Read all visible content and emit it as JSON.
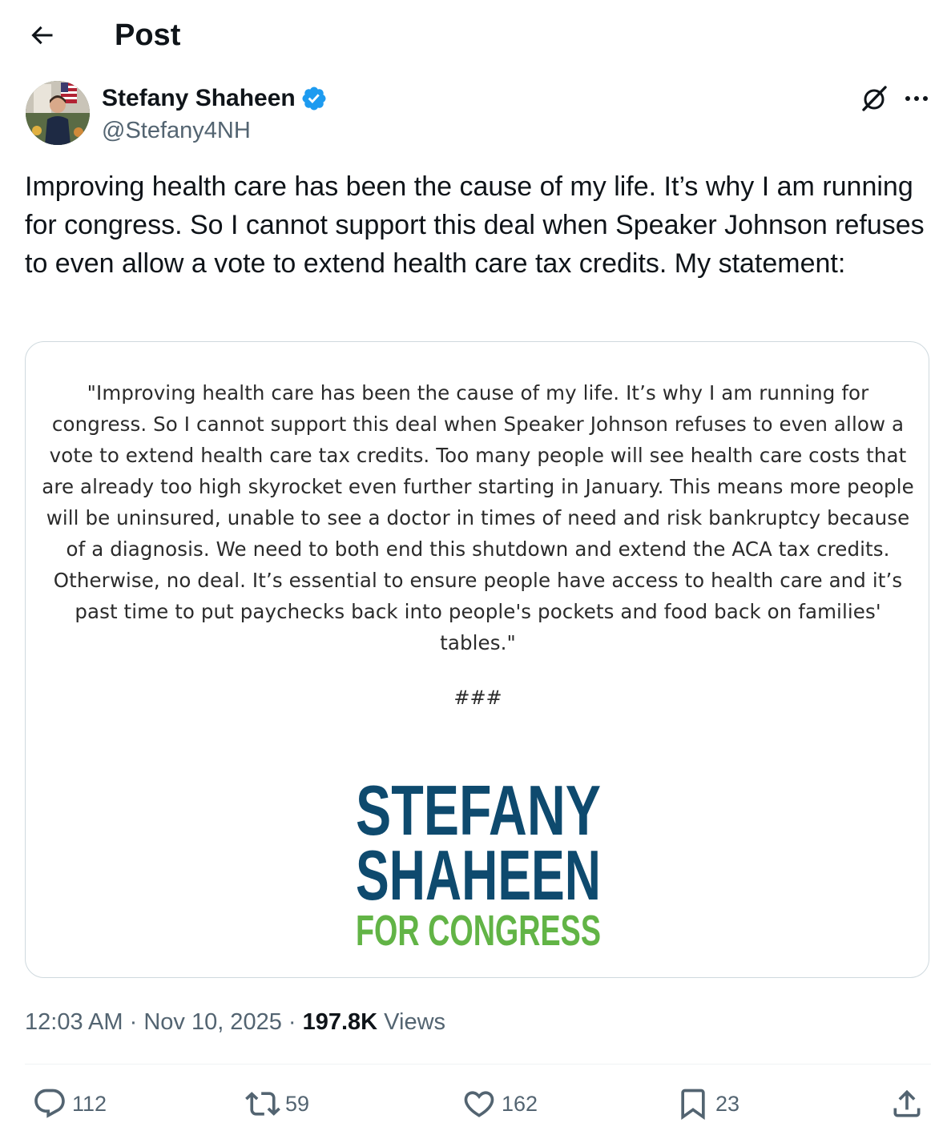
{
  "header": {
    "title": "Post",
    "back_icon": "back-arrow-icon"
  },
  "author": {
    "name": "Stefany Shaheen",
    "handle": "@Stefany4NH",
    "verified": true,
    "verified_color": "#1d9bf0"
  },
  "tweet": {
    "text": "Improving health care has been the cause of my life. It’s why I am running for congress. So I cannot support this deal when Speaker Johnson refuses to even allow a vote to extend health care tax credits. My statement:"
  },
  "card": {
    "statement": "\"Improving health care has been the cause of my life. It’s why I am running for congress. So I cannot support this deal when Speaker Johnson refuses to even allow a vote to extend health care tax credits. Too many people will see health care costs that are already too high skyrocket even further starting in January. This means more people will be uninsured, unable to see a doctor in times of need and risk bankruptcy because of a diagnosis.  We need to both end this shutdown and extend the ACA tax credits. Otherwise, no deal. It’s essential to ensure people have access to health care and it’s past time to put paychecks back into people's pockets and food back on families' tables.\"",
    "hashes": "###",
    "logo": {
      "line1": "STEFANY",
      "line2": "SHAHEEN",
      "line3": "FOR CONGRESS",
      "primary_color": "#0e4a6e",
      "secondary_color": "#62b446"
    }
  },
  "meta": {
    "time": "12:03 AM",
    "sep1": " · ",
    "date": "Nov 10, 2025",
    "sep2": " · ",
    "views_count": "197.8K",
    "views_label": " Views"
  },
  "actions": {
    "replies": "112",
    "reposts": "59",
    "likes": "162",
    "bookmarks": "23"
  },
  "colors": {
    "text": "#0f1419",
    "secondary": "#536471",
    "border": "#cfd9de"
  }
}
